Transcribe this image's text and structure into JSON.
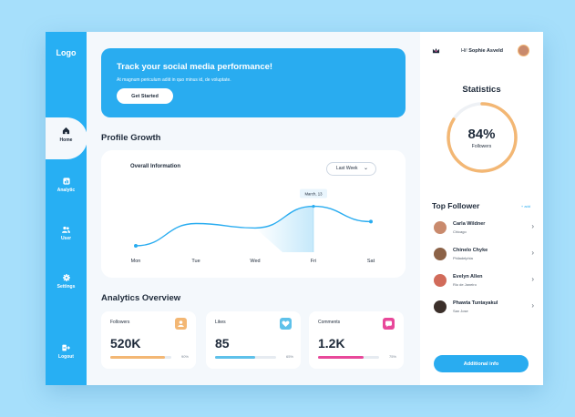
{
  "sidebar": {
    "logo": "Logo",
    "items": [
      {
        "label": "Home",
        "icon": "home-icon",
        "active": true
      },
      {
        "label": "Analytic",
        "icon": "analytic-icon"
      },
      {
        "label": "User",
        "icon": "users-icon"
      },
      {
        "label": "Settings",
        "icon": "gear-icon"
      },
      {
        "label": "Logout",
        "icon": "logout-icon"
      }
    ]
  },
  "banner": {
    "title": "Track your social media performance!",
    "subtitle": "At magnum periculum adiit in quo minus id, de voluptate.",
    "button": "Get Started"
  },
  "growth": {
    "section_title": "Profile Growth",
    "card_title": "Overall Information",
    "dropdown": "Last Week"
  },
  "chart_data": {
    "type": "line",
    "categories": [
      "Mon",
      "Tue",
      "Wed",
      "Fri",
      "Sat"
    ],
    "values": [
      10,
      45,
      38,
      72,
      48
    ],
    "highlight": {
      "category": "Fri",
      "label": "March, 13"
    },
    "color": "#29acf0",
    "ylim": [
      0,
      100
    ],
    "grid": false
  },
  "analytics": {
    "section_title": "Analytics Overview",
    "cards": [
      {
        "label": "Followers",
        "value": "520K",
        "pct_label": "90%",
        "pct": 0.9,
        "color": "#f3b774",
        "icon": "user-icon"
      },
      {
        "label": "Likes",
        "value": "85",
        "pct_label": "65%",
        "pct": 0.65,
        "color": "#5ec1ea",
        "icon": "heart-icon"
      },
      {
        "label": "Comments",
        "value": "1.2K",
        "pct_label": "75%",
        "pct": 0.75,
        "color": "#e8489a",
        "icon": "comment-icon"
      }
    ]
  },
  "header": {
    "greeting": "Hi!",
    "user": "Sophie Asveld"
  },
  "statistics": {
    "title": "Statistics",
    "percent": "84%",
    "value": 0.84,
    "label": "Followers",
    "color": "#f3b774"
  },
  "top_follower": {
    "title": "Top Follower",
    "link": "+ add",
    "items": [
      {
        "name": "Carla Wildner",
        "city": "Chicago",
        "color": "#c98a6d"
      },
      {
        "name": "Chinelo Chyke",
        "city": "Philadelphia",
        "color": "#8c6247"
      },
      {
        "name": "Evelyn Allen",
        "city": "Rio de Janeiro",
        "color": "#d16b5a"
      },
      {
        "name": "Phawta Tuntayakul",
        "city": "San Jose",
        "color": "#3b2f2a"
      }
    ],
    "button": "Additional info"
  }
}
